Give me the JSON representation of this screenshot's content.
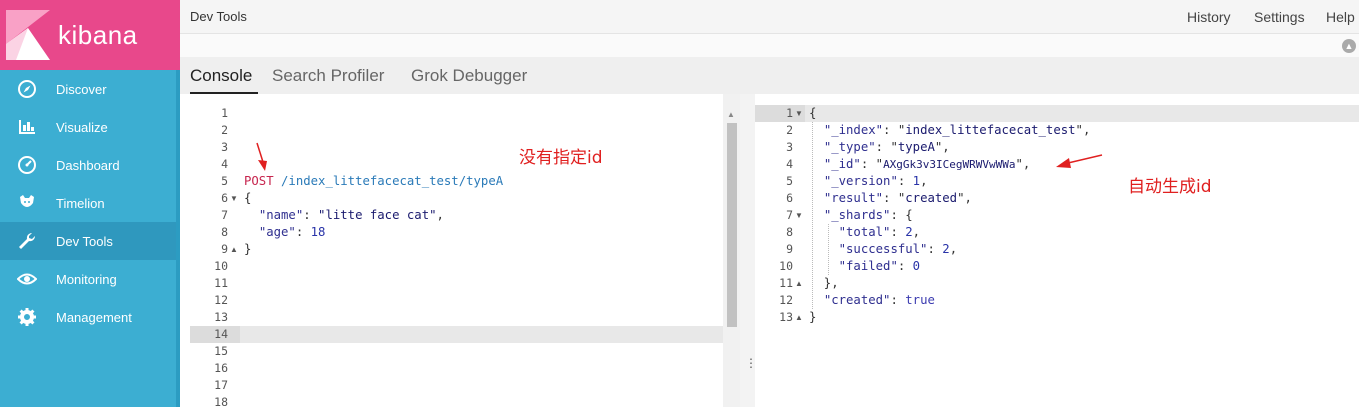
{
  "brand": {
    "name": "kibana",
    "color": "#e8488b",
    "sidebar_color": "#3caed2"
  },
  "sidebar": {
    "items": [
      {
        "label": "Discover",
        "icon": "compass-icon"
      },
      {
        "label": "Visualize",
        "icon": "bar-chart-icon"
      },
      {
        "label": "Dashboard",
        "icon": "dashboard-gauge-icon"
      },
      {
        "label": "Timelion",
        "icon": "timelion-icon"
      },
      {
        "label": "Dev Tools",
        "icon": "wrench-icon",
        "active": true
      },
      {
        "label": "Monitoring",
        "icon": "eye-icon"
      },
      {
        "label": "Management",
        "icon": "gear-icon"
      }
    ]
  },
  "topbar": {
    "title": "Dev Tools",
    "links": [
      "History",
      "Settings",
      "Help"
    ]
  },
  "tabs": [
    {
      "label": "Console",
      "active": true
    },
    {
      "label": "Search Profiler"
    },
    {
      "label": "Grok Debugger"
    }
  ],
  "request_editor": {
    "line_numbers": [
      "1",
      "2",
      "3",
      "4",
      "5",
      "6",
      "7",
      "8",
      "9",
      "10",
      "11",
      "12",
      "13",
      "14",
      "15",
      "16",
      "17",
      "18"
    ],
    "active_line": "14",
    "lines": {
      "method": "POST",
      "url": "/index_littefacecat_test/typeA",
      "open_brace": "{",
      "name_key": "\"name\"",
      "name_value": "\"litte face cat\"",
      "age_key": "\"age\"",
      "age_value": "18",
      "close_brace": "}"
    }
  },
  "response_editor": {
    "line_numbers": [
      "1",
      "2",
      "3",
      "4",
      "5",
      "6",
      "7",
      "8",
      "9",
      "10",
      "11",
      "12",
      "13"
    ],
    "json": {
      "_index": "index_littefacecat_test",
      "_type": "typeA",
      "_id": "AXgGk3v3ICegWRWVwWWa",
      "_version": "1",
      "result": "created",
      "total": "2",
      "successful": "2",
      "failed": "0",
      "created": "true"
    }
  },
  "annotations": {
    "left": "没有指定id",
    "right": "自动生成id",
    "color": "#e02020"
  }
}
